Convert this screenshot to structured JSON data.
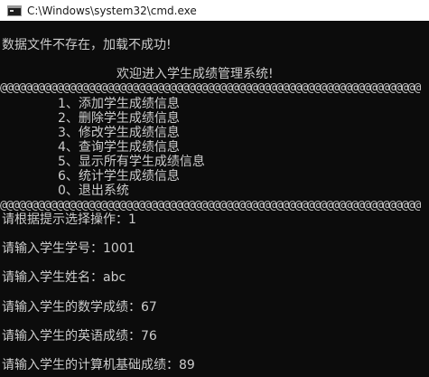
{
  "window": {
    "title": "C:\\Windows\\system32\\cmd.exe"
  },
  "console": {
    "error_line": "数据文件不存在，加载不成功!",
    "welcome": "欢迎进入学生成绩管理系统!",
    "separator": "@@@@@@@@@@@@@@@@@@@@@@@@@@@@@@@@@@@@@@@@@@@@@@@@@@@@@@@@@@@@@@@@@@@",
    "menu": [
      "1、添加学生成绩信息",
      "2、删除学生成绩信息",
      "3、修改学生成绩信息",
      "4、查询学生成绩信息",
      "5、显示所有学生成绩信息",
      "6、统计学生成绩信息",
      "0、退出系统"
    ],
    "prompts": [
      "请根据提示选择操作：1",
      "请输入学生学号：1001",
      "请输入学生姓名：abc",
      "请输入学生的数学成绩：67",
      "请输入学生的英语成绩：76",
      "请输入学生的计算机基础成绩：89"
    ]
  }
}
